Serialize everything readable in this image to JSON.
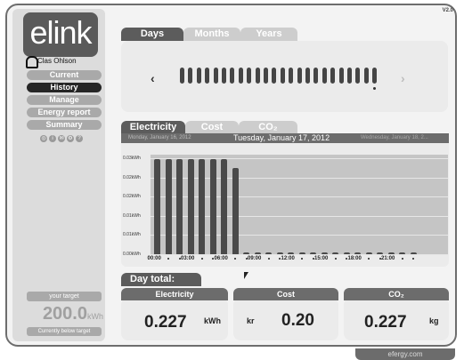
{
  "app": {
    "logo_text": "elink",
    "version": "V2.0",
    "user_name": "Clas Ohlson",
    "footer": "efergy.com"
  },
  "nav": {
    "items": [
      "Current",
      "History",
      "Manage",
      "Energy report",
      "Summary"
    ],
    "active": "History",
    "round_icons": [
      "settings-icon",
      "info-icon",
      "mail-icon",
      "gear-icon",
      "help-icon"
    ]
  },
  "target": {
    "label": "your target",
    "value": "200.0",
    "unit": "kWh",
    "status": "Currently below target"
  },
  "period_tabs": [
    "Days",
    "Months",
    "Years"
  ],
  "period_active": "Days",
  "day_selector": {
    "prev": "‹",
    "next": "›",
    "count": 24,
    "selected_index": 23
  },
  "metric_tabs": [
    "Electricity",
    "Cost",
    "CO₂"
  ],
  "metric_active": "Electricity",
  "date_bar": {
    "prev": "Monday, January 16, 2012",
    "current": "Tuesday, January 17, 2012",
    "next": "Wednesday, January 18, 2..."
  },
  "chart_data": {
    "type": "bar",
    "categories": [
      "00:00",
      "01:00",
      "02:00",
      "03:00",
      "04:00",
      "05:00",
      "06:00",
      "07:00",
      "08:00",
      "09:00",
      "10:00",
      "11:00",
      "12:00",
      "13:00",
      "14:00",
      "15:00",
      "16:00",
      "17:00",
      "18:00",
      "19:00",
      "20:00",
      "21:00",
      "22:00",
      "23:00"
    ],
    "values": [
      0.0248,
      0.0248,
      0.0248,
      0.0248,
      0.0248,
      0.0248,
      0.0248,
      0.0225,
      0.0005,
      0.0005,
      0.0005,
      0.0005,
      0.0005,
      0.0005,
      0.0005,
      0.0005,
      0.0005,
      0.0005,
      0.0005,
      0.0005,
      0.0005,
      0.0005,
      0.0005,
      0.0005
    ],
    "ylim": [
      0,
      0.026
    ],
    "y_ticks": [
      0,
      0.005,
      0.01,
      0.015,
      0.02,
      0.025
    ],
    "y_tick_labels": [
      "0.00kWh",
      "0.01kWh",
      "0.01kWh",
      "0.02kWh",
      "0.02kWh",
      "0.03kWh"
    ],
    "x_tick_labels": [
      "00:00",
      "03:00",
      "06:00",
      "09:00",
      "12:00",
      "15:00",
      "18:00",
      "21:00"
    ],
    "grid": true
  },
  "day_total": {
    "title": "Day total:",
    "electricity": {
      "label": "Electricity",
      "value": "0.227",
      "unit": "kWh"
    },
    "cost": {
      "label": "Cost",
      "currency": "kr",
      "value": "0.20"
    },
    "co2": {
      "label": "CO₂",
      "value": "0.227",
      "unit": "kg"
    }
  },
  "colors": {
    "dark": "#262626",
    "panel": "#ebebeb",
    "bar": "#4a4a4a",
    "header": "#6c6c6c"
  }
}
